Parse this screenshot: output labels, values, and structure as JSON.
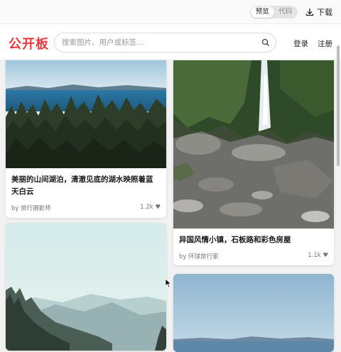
{
  "topbar": {
    "toggle_preview": "预览",
    "toggle_code": "代码",
    "download_label": "下载"
  },
  "header": {
    "logo": "公开板",
    "search_placeholder": "搜索图片、用户或标签...",
    "login": "登录",
    "register": "注册"
  },
  "cards": [
    {
      "title_line1": "美丽的山间湖泊，清澈见底的湖水映照着蓝",
      "title_line2": "天白云",
      "author": "by 旅行摄影师",
      "likes": "1.2k ♥"
    },
    {
      "title": "异国风情小镇，石板路和彩色房屋",
      "author": "by 环球旅行家",
      "likes": "1.1k ♥"
    }
  ],
  "colors": {
    "brand": "#e8383d",
    "background": "#f2f2f2"
  }
}
